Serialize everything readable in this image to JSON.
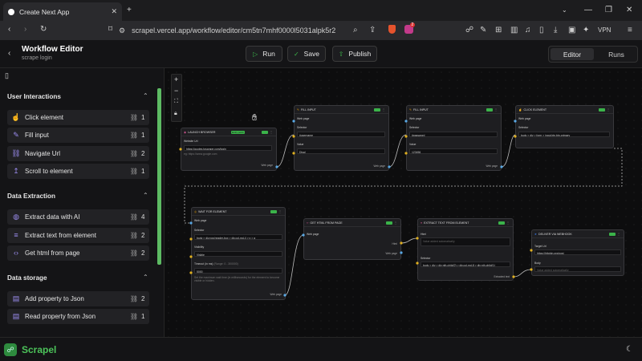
{
  "browser": {
    "tab_title": "Create Next App",
    "url": "scrapel.vercel.app/workflow/editor/cm5tn7mhf0000l5031alpk5r2",
    "vpn_label": "VPN",
    "brave_badge": "2"
  },
  "header": {
    "title": "Workflow Editor",
    "subtitle": "scrape login",
    "run_label": "Run",
    "save_label": "Save",
    "publish_label": "Publish",
    "tab_editor": "Editor",
    "tab_runs": "Runs"
  },
  "sidebar": {
    "sections": [
      {
        "title": "User Interactions",
        "items": [
          {
            "label": "Click element",
            "count": "1",
            "icon": "pointer-icon"
          },
          {
            "label": "Fill input",
            "count": "1",
            "icon": "edit-icon"
          },
          {
            "label": "Navigate Url",
            "count": "2",
            "icon": "link-icon"
          },
          {
            "label": "Scroll to element",
            "count": "1",
            "icon": "arrow-up-icon"
          }
        ]
      },
      {
        "title": "Data Extraction",
        "items": [
          {
            "label": "Extract data with AI",
            "count": "4",
            "icon": "brain-icon"
          },
          {
            "label": "Extract text from element",
            "count": "2",
            "icon": "text-icon"
          },
          {
            "label": "Get html from page",
            "count": "2",
            "icon": "code-icon"
          }
        ]
      },
      {
        "title": "Data storage",
        "items": [
          {
            "label": "Add property to Json",
            "count": "2",
            "icon": "database-icon"
          },
          {
            "label": "Read property from Json",
            "count": "1",
            "icon": "database-icon"
          }
        ]
      }
    ]
  },
  "footer": {
    "brand": "Scrapel"
  },
  "nodes": {
    "launch": {
      "title": "LAUNCH BROWSER",
      "badge": "Entry point",
      "field_label": "Website Url",
      "value": "https://quotes.toscrape.com/login",
      "hint": "eg: https://www.google.com",
      "out": "Web page"
    },
    "fill1": {
      "title": "FILL INPUT",
      "in": "Web page",
      "sel_label": "Selector",
      "sel": "#username",
      "val_label": "Value",
      "val": "Djsal",
      "out": "Web page"
    },
    "fill2": {
      "title": "FILL INPUT",
      "in": "Web page",
      "sel_label": "Selector",
      "sel": "#password",
      "val_label": "Value",
      "val": "123456",
      "out": "Web page"
    },
    "click": {
      "title": "CLICK ELEMENT",
      "in": "Web page",
      "sel_label": "Selector",
      "sel": "body > div > form > input.btn.btn-primary"
    },
    "wait": {
      "title": "WAIT FOR ELEMENT",
      "in": "Web page",
      "sel_label": "Selector",
      "sel": "body > div.row.header-box > div.col-md-4 > p > a",
      "vis_label": "Visibility",
      "vis": "Visible",
      "timeout_label": "Timeout (in ms)",
      "timeout_hint": "(Range: 0 - 300000)",
      "timeout": "5000",
      "desc": "Set the maximum wait time (in milliseconds) for the element to become visible or hidden.",
      "out": "Web page"
    },
    "gethtml": {
      "title": "GET HTML FROM PAGE",
      "in": "Web page",
      "out1": "Html",
      "out2": "Web page"
    },
    "extract": {
      "title": "EXTRACT TEXT FROM ELEMENT",
      "html_label": "Html",
      "html_ph": "Value added automatically",
      "sel_label": "Selector",
      "sel": "body > div > div:nth-child(2) > div.col-md-8 > div:nth-child(1)",
      "out": "Extracted text"
    },
    "webhook": {
      "title": "DELIVER VIA WEBHOOK",
      "url_label": "Target Url",
      "url": "https://httpbin.org/post",
      "body_label": "Body",
      "body_ph": "Value added automatically"
    }
  },
  "colors": {
    "accent": "#3bb34a",
    "sidebar_icon": "#9c8df0",
    "edge": "#bbbbbb"
  }
}
